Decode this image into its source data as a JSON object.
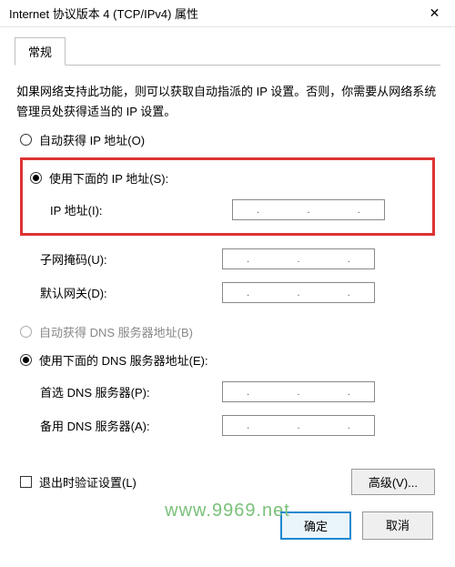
{
  "window": {
    "title": "Internet 协议版本 4 (TCP/IPv4) 属性"
  },
  "tab": {
    "general": "常规"
  },
  "description": "如果网络支持此功能，则可以获取自动指派的 IP 设置。否则，你需要从网络系统管理员处获得适当的 IP 设置。",
  "ip_section": {
    "auto": "自动获得 IP 地址(O)",
    "manual": "使用下面的 IP 地址(S):",
    "ip_label": "IP 地址(I):",
    "subnet_label": "子网掩码(U):",
    "gateway_label": "默认网关(D):"
  },
  "dns_section": {
    "auto": "自动获得 DNS 服务器地址(B)",
    "manual": "使用下面的 DNS 服务器地址(E):",
    "preferred_label": "首选 DNS 服务器(P):",
    "alternate_label": "备用 DNS 服务器(A):"
  },
  "exit_validate": "退出时验证设置(L)",
  "buttons": {
    "advanced": "高级(V)...",
    "ok": "确定",
    "cancel": "取消"
  },
  "watermark": "www.9969.net"
}
